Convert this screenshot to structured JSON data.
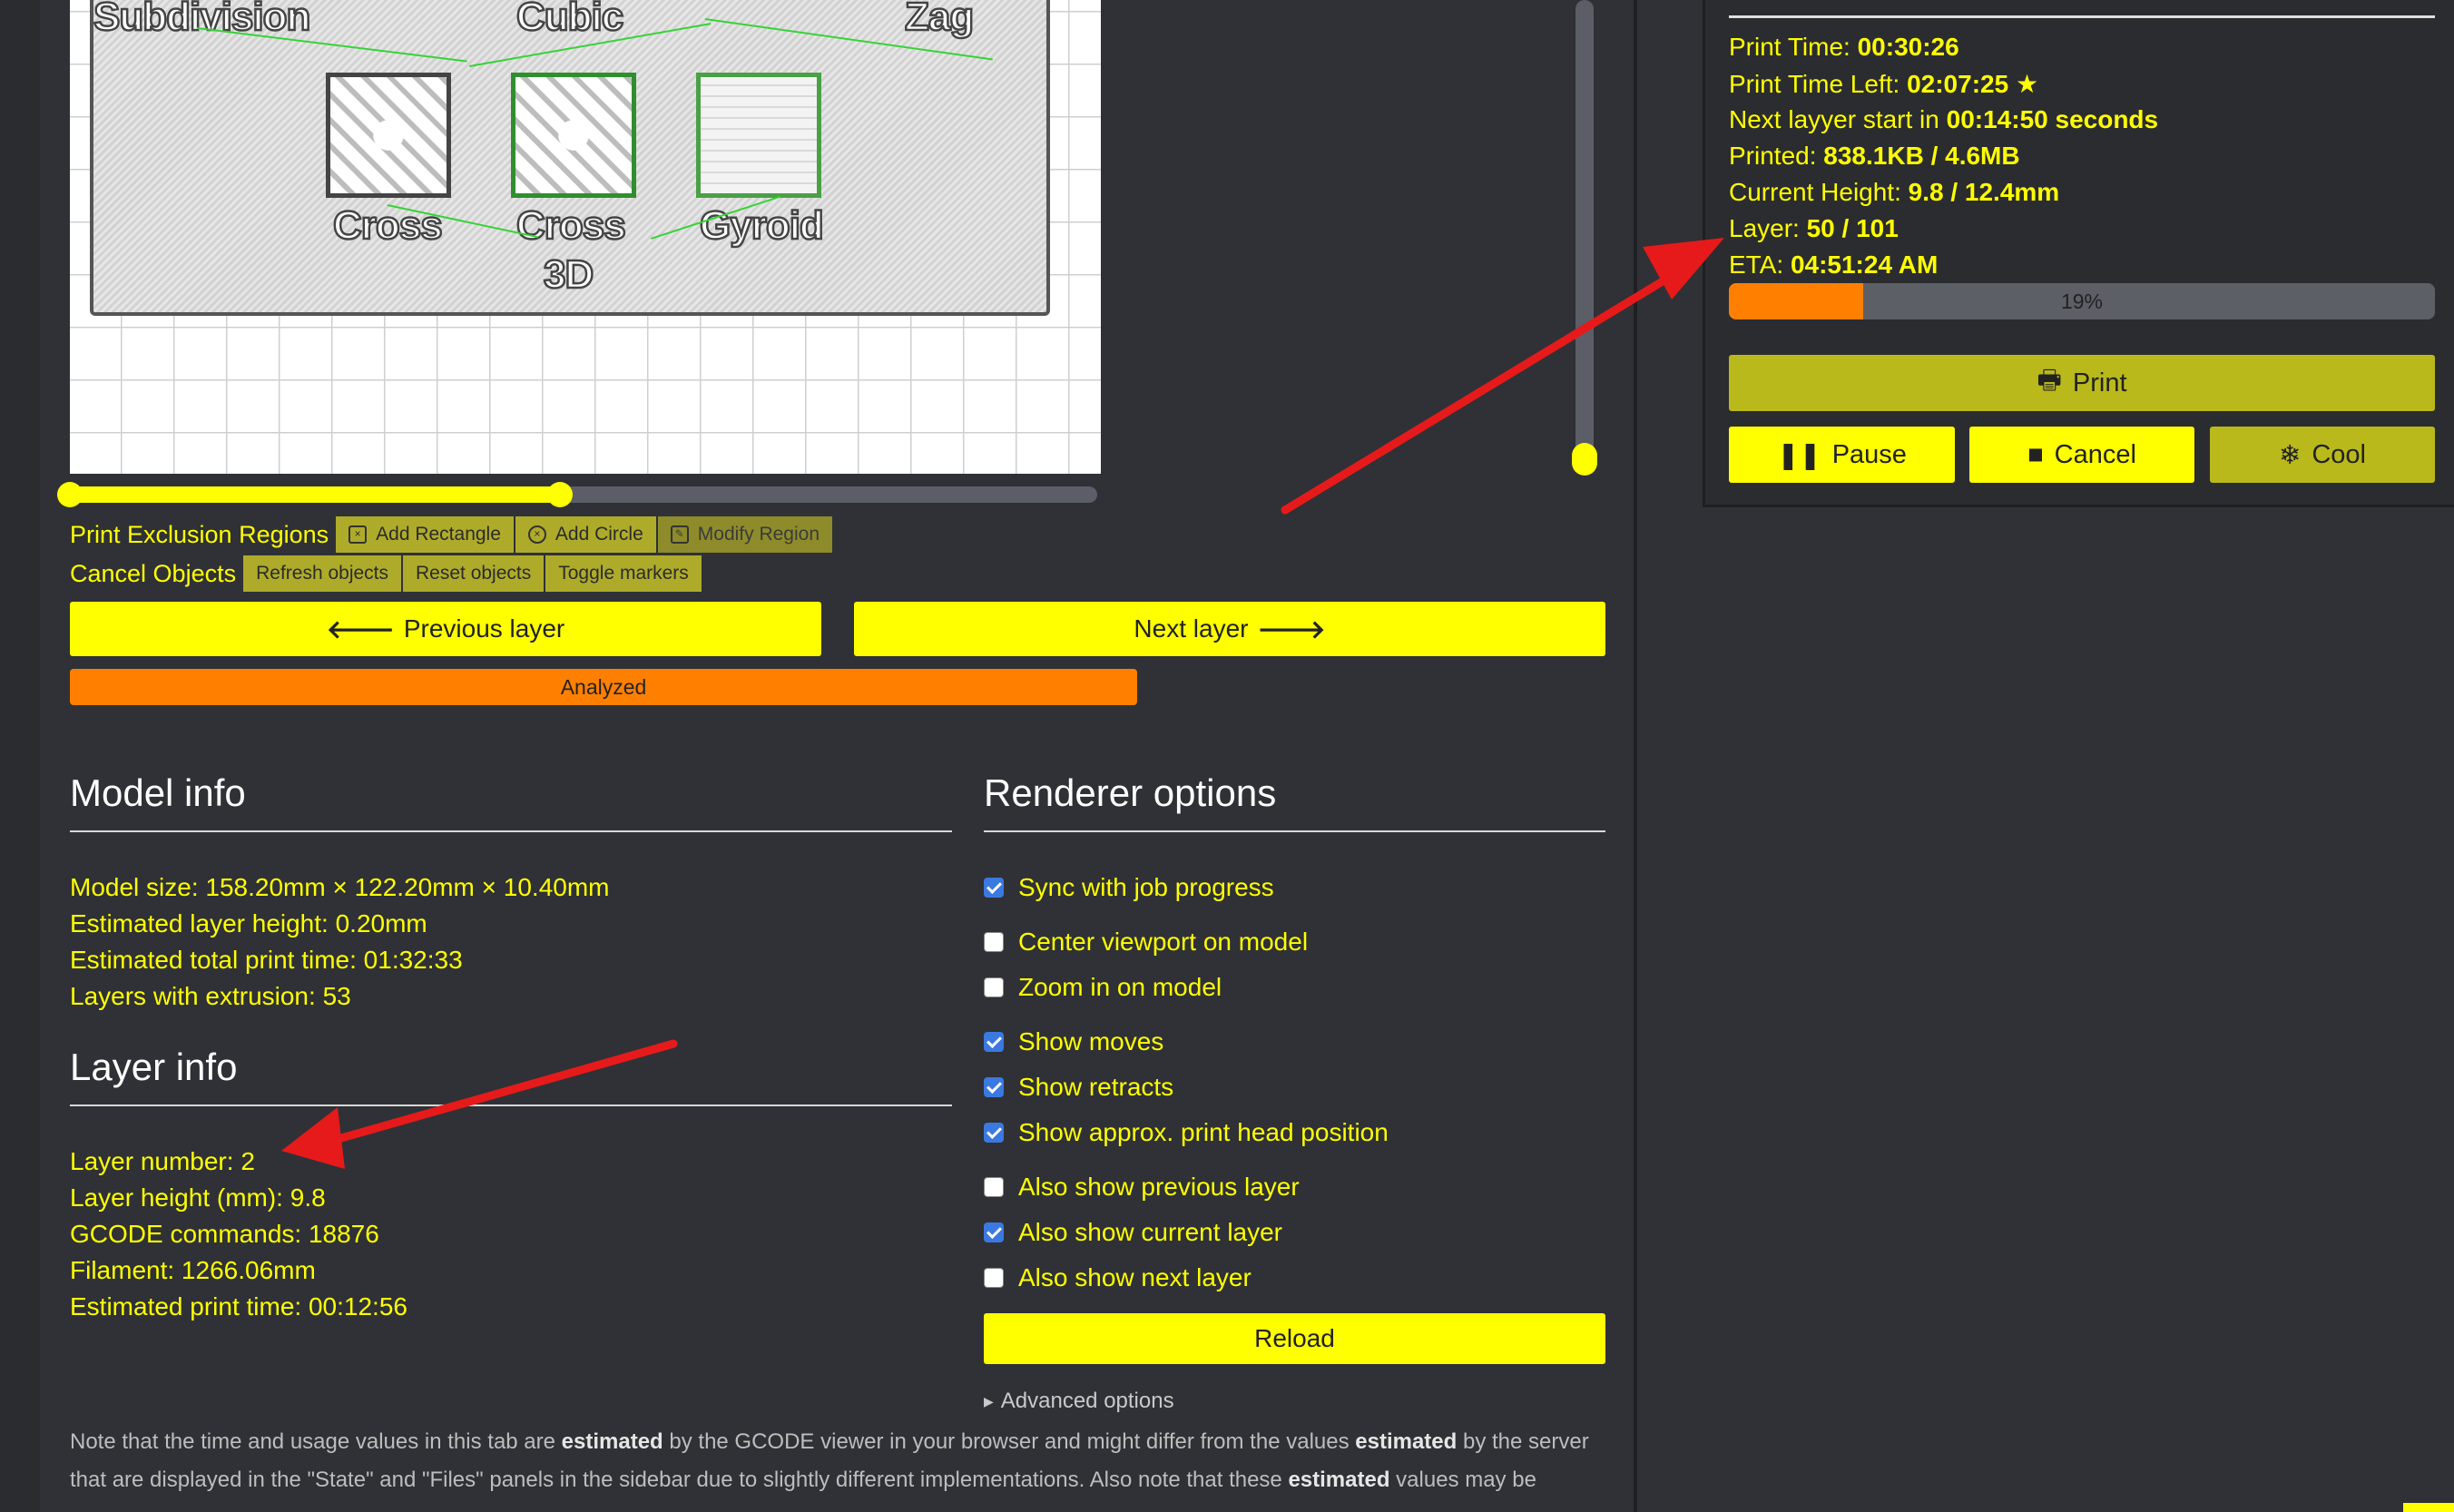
{
  "viewer": {
    "part_labels": [
      "Subdivision",
      "Cubic",
      "Zag",
      "Cross",
      "Cross",
      "3D",
      "Gyroid"
    ]
  },
  "exclusion": {
    "label": "Print Exclusion Regions",
    "buttons": [
      "Add Rectangle",
      "Add Circle",
      "Modify Region"
    ]
  },
  "cancel_objects": {
    "label": "Cancel Objects",
    "buttons": [
      "Refresh objects",
      "Reset objects",
      "Toggle markers"
    ]
  },
  "nav": {
    "prev": "Previous layer",
    "next": "Next layer",
    "prev_icon": "arrow-left-icon",
    "next_icon": "arrow-right-icon"
  },
  "analyzed": "Analyzed",
  "model_info": {
    "title": "Model info",
    "lines": [
      "Model size: 158.20mm × 122.20mm × 10.40mm",
      "Estimated layer height: 0.20mm",
      "Estimated total print time: 01:32:33",
      "Layers with extrusion: 53"
    ]
  },
  "layer_info": {
    "title": "Layer info",
    "lines": [
      "Layer number: 2",
      "Layer height (mm): 9.8",
      "GCODE commands: 18876",
      "Filament: 1266.06mm",
      "Estimated print time: 00:12:56"
    ]
  },
  "renderer": {
    "title": "Renderer options",
    "options": [
      {
        "label": "Sync with job progress",
        "checked": true
      },
      {
        "label": "Center viewport on model",
        "checked": false
      },
      {
        "label": "Zoom in on model",
        "checked": false
      },
      {
        "label": "Show moves",
        "checked": true
      },
      {
        "label": "Show retracts",
        "checked": true
      },
      {
        "label": "Show approx. print head position",
        "checked": true
      },
      {
        "label": "Also show previous layer",
        "checked": false
      },
      {
        "label": "Also show current layer",
        "checked": true
      },
      {
        "label": "Also show next layer",
        "checked": false
      }
    ],
    "reload": "Reload",
    "advanced": "Advanced options"
  },
  "note": {
    "p1": "Note that the time and usage values in this tab are ",
    "b1": "estimated",
    "p2": " by the GCODE viewer in your browser and might differ from the values ",
    "b2": "estimated",
    "p3": " by the server that are displayed in the \"State\" and \"Files\" panels in the sidebar due to slightly different implementations. Also note that these ",
    "b3": "estimated",
    "p4": " values may be"
  },
  "sidebar": {
    "stats": [
      {
        "label": "Print Time: ",
        "value": "00:30:26",
        "suffix": ""
      },
      {
        "label": "Print Time Left: ",
        "value": "02:07:25",
        "suffix": " ★"
      },
      {
        "label": "Next layyer start in ",
        "value": "00:14:50 seconds",
        "suffix": ""
      },
      {
        "label": "Printed: ",
        "value": "838.1KB / 4.6MB",
        "suffix": ""
      },
      {
        "label": "Current Height: ",
        "value": "9.8 / 12.4mm",
        "suffix": ""
      },
      {
        "label": "Layer: ",
        "value": "50 / 101",
        "suffix": ""
      },
      {
        "label": "ETA: ",
        "value": "04:51:24 AM",
        "suffix": ""
      }
    ],
    "progress": {
      "percent": 19,
      "label": "19%"
    },
    "print": "Print",
    "pause": "Pause",
    "cancel": "Cancel",
    "cool": "Cool"
  },
  "colors": {
    "accent": "#ffff00",
    "orange": "#ff8000",
    "olive": "#b9b91b",
    "bg": "#2f3136",
    "checkbox": "#3a79e0",
    "annotation_arrow": "#e61a1a"
  }
}
